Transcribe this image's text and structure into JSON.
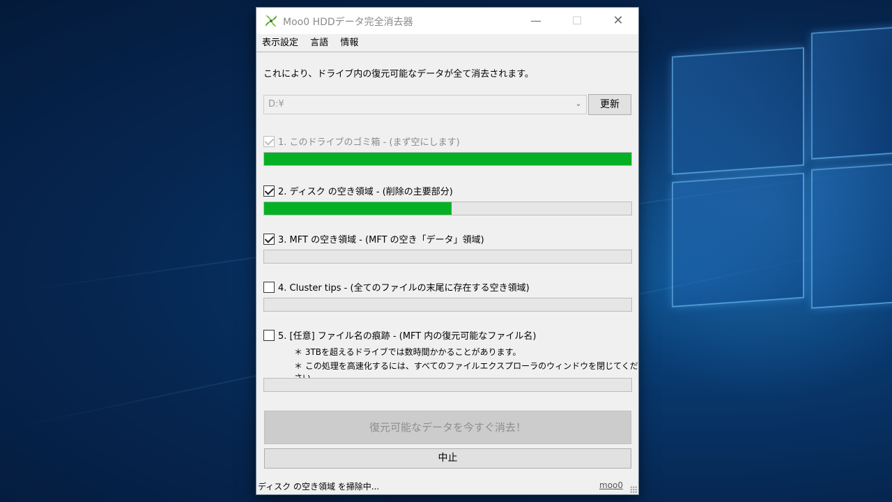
{
  "window": {
    "title": "Moo0 HDDデータ完全消去器",
    "controls": {
      "minimize": "—",
      "maximize": "☐",
      "close": "✕"
    }
  },
  "menu": [
    "表示設定",
    "言語",
    "情報"
  ],
  "description": "これにより、ドライブ内の復元可能なデータが全て消去されます。",
  "drive": {
    "selected": "D:¥",
    "refresh_label": "更新"
  },
  "options": [
    {
      "label": "1. このドライブのゴミ箱 - (まず空にします)",
      "checked": true,
      "disabled": true,
      "progress": 1.0
    },
    {
      "label": "2. ディスク の空き領域 - (削除の主要部分)",
      "checked": true,
      "disabled": false,
      "progress": 0.51
    },
    {
      "label": "3. MFT の空き領域 - (MFT の空き「データ」領域)",
      "checked": true,
      "disabled": false,
      "progress": 0.0
    },
    {
      "label": "4. Cluster tips - (全てのファイルの末尾に存在する空き領域)",
      "checked": false,
      "disabled": false,
      "progress": 0.0
    },
    {
      "label": "5. [任意]  ファイル名の痕跡 - (MFT 内の復元可能なファイル名)",
      "checked": false,
      "disabled": false,
      "progress": 0.0
    }
  ],
  "notes": [
    "＊ 3TBを超えるドライブでは数時間かかることがあります。",
    "＊ この処理を高速化するには、すべてのファイルエクスプローラのウィンドウを閉じてください。"
  ],
  "buttons": {
    "erase": "復元可能なデータを今すぐ消去！",
    "stop": "中止"
  },
  "status": {
    "text": "ディスク の空き領域 を掃除中...",
    "link": "moo0"
  },
  "colors": {
    "progress": "#06b025",
    "window_bg": "#f0f0f0"
  }
}
